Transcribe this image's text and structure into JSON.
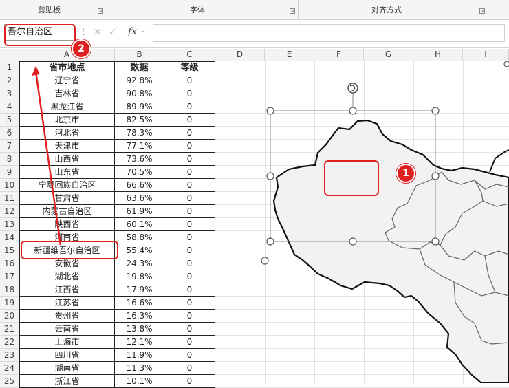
{
  "ribbon": {
    "groups": [
      "剪贴板",
      "字体",
      "对齐方式"
    ]
  },
  "formula_bar": {
    "name_box": "吾尔自治区",
    "fx_label": "fx",
    "cancel_glyph": "✕",
    "confirm_glyph": "✓",
    "value": ""
  },
  "columns": [
    "A",
    "B",
    "C",
    "D",
    "E",
    "F",
    "G",
    "H",
    "I"
  ],
  "rows": [
    "1",
    "2",
    "3",
    "4",
    "5",
    "6",
    "7",
    "8",
    "9",
    "10",
    "11",
    "12",
    "13",
    "14",
    "15",
    "16",
    "17",
    "18",
    "19",
    "20",
    "21",
    "22",
    "23",
    "24",
    "25"
  ],
  "table": {
    "headers": [
      "省市地点",
      "数据",
      "等级"
    ],
    "rows": [
      [
        "辽宁省",
        "92.8%",
        "0"
      ],
      [
        "吉林省",
        "90.8%",
        "0"
      ],
      [
        "黑龙江省",
        "89.9%",
        "0"
      ],
      [
        "北京市",
        "82.5%",
        "0"
      ],
      [
        "河北省",
        "78.3%",
        "0"
      ],
      [
        "天津市",
        "77.1%",
        "0"
      ],
      [
        "山西省",
        "73.6%",
        "0"
      ],
      [
        "山东省",
        "70.5%",
        "0"
      ],
      [
        "宁夏回族自治区",
        "66.6%",
        "0"
      ],
      [
        "甘肃省",
        "63.6%",
        "0"
      ],
      [
        "内蒙古自治区",
        "61.9%",
        "0"
      ],
      [
        "陕西省",
        "60.1%",
        "0"
      ],
      [
        "河南省",
        "58.8%",
        "0"
      ],
      [
        "新疆维吾尔自治区",
        "55.4%",
        "0"
      ],
      [
        "安徽省",
        "24.3%",
        "0"
      ],
      [
        "湖北省",
        "19.8%",
        "0"
      ],
      [
        "江西省",
        "17.9%",
        "0"
      ],
      [
        "江苏省",
        "16.6%",
        "0"
      ],
      [
        "贵州省",
        "16.3%",
        "0"
      ],
      [
        "云南省",
        "13.8%",
        "0"
      ],
      [
        "上海市",
        "12.1%",
        "0"
      ],
      [
        "四川省",
        "11.9%",
        "0"
      ],
      [
        "湖南省",
        "11.3%",
        "0"
      ],
      [
        "浙江省",
        "10.1%",
        "0"
      ]
    ]
  },
  "annotations": {
    "badge_1": "1",
    "badge_2": "2"
  },
  "colors": {
    "annotation_red": "#e02020",
    "map_fill": "#f2f2f2",
    "map_border": "#111111"
  },
  "icons": {
    "rotate_handle": "rotate-icon",
    "launcher": "dialog-launcher-icon"
  }
}
